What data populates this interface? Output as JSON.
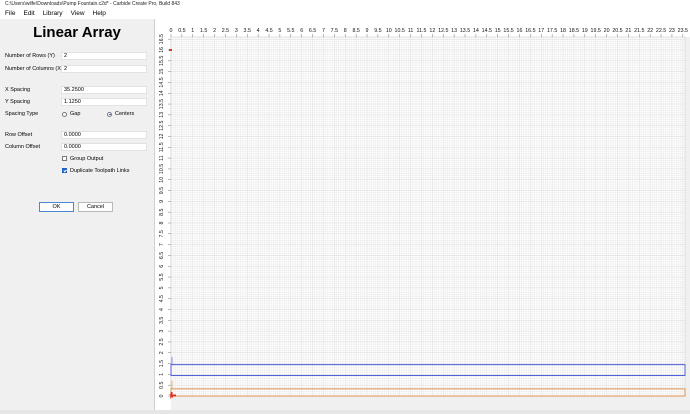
{
  "window": {
    "title": "C:\\Users\\wilfe\\Downloads\\Pump Fountain.c2d* - Carbide Create Pro, Build 843"
  },
  "menu": [
    "File",
    "Edit",
    "Library",
    "View",
    "Help"
  ],
  "panel": {
    "title": "Linear Array",
    "rows_label": "Number of Rows (Y)",
    "rows_value": "2",
    "cols_label": "Number of Columns (X)",
    "cols_value": "2",
    "xspacing_label": "X Spacing",
    "xspacing_value": "35.2500",
    "yspacing_label": "Y Spacing",
    "yspacing_value": "1.1250",
    "spacing_type_label": "Spacing Type",
    "gap_label": "Gap",
    "centers_label": "Centers",
    "spacing_type_selected": "Centers",
    "row_offset_label": "Row Offset",
    "row_offset_value": "0.0000",
    "col_offset_label": "Column Offset",
    "col_offset_value": "0.0000",
    "group_output_label": "Group Output",
    "group_output_checked": false,
    "dup_links_label": "Duplicate Toolpath Links",
    "dup_links_checked": true,
    "ok_label": "OK",
    "cancel_label": "Cancel"
  },
  "canvas": {
    "x_ticks": [
      "0",
      "0.5",
      "1",
      "1.5",
      "2",
      "2.5",
      "3",
      "3.5",
      "4",
      "4.5",
      "5",
      "5.5",
      "6",
      "6.5",
      "7",
      "7.5",
      "8",
      "8.5",
      "9",
      "9.5",
      "10",
      "10.5",
      "11",
      "11.5",
      "12",
      "12.5",
      "13",
      "13.5",
      "14",
      "14.5",
      "15",
      "15.5",
      "16",
      "16.5",
      "17",
      "17.5",
      "18",
      "18.5",
      "19",
      "19.5",
      "20",
      "20.5",
      "21",
      "21.5",
      "22",
      "22.5",
      "23",
      "23.5"
    ],
    "y_ticks": [
      "0",
      "0.5",
      "1",
      "1.5",
      "2",
      "2.5",
      "3",
      "3.5",
      "4",
      "4.5",
      "5",
      "5.5",
      "6",
      "6.5",
      "7",
      "7.5",
      "8",
      "8.5",
      "9",
      "9.5",
      "10",
      "10.5",
      "11",
      "11.5",
      "12",
      "12.5",
      "13",
      "13.5",
      "14",
      "14.5",
      "15",
      "15.5",
      "16",
      "16.5"
    ],
    "colors": {
      "grid_minor": "#e4e4e4",
      "grid_major": "#cfcfcf",
      "selection": "#3f4fd8",
      "toolpath": "#e08a3c",
      "origin": "#e03020"
    },
    "shapes": {
      "selected_rect": {
        "x0": 0,
        "y0": 0.95,
        "x1": 23.6,
        "y1": 1.45
      },
      "toolpath_rect": {
        "x0": 0,
        "y0": 0.0,
        "x1": 23.6,
        "y1": 0.33
      }
    }
  }
}
